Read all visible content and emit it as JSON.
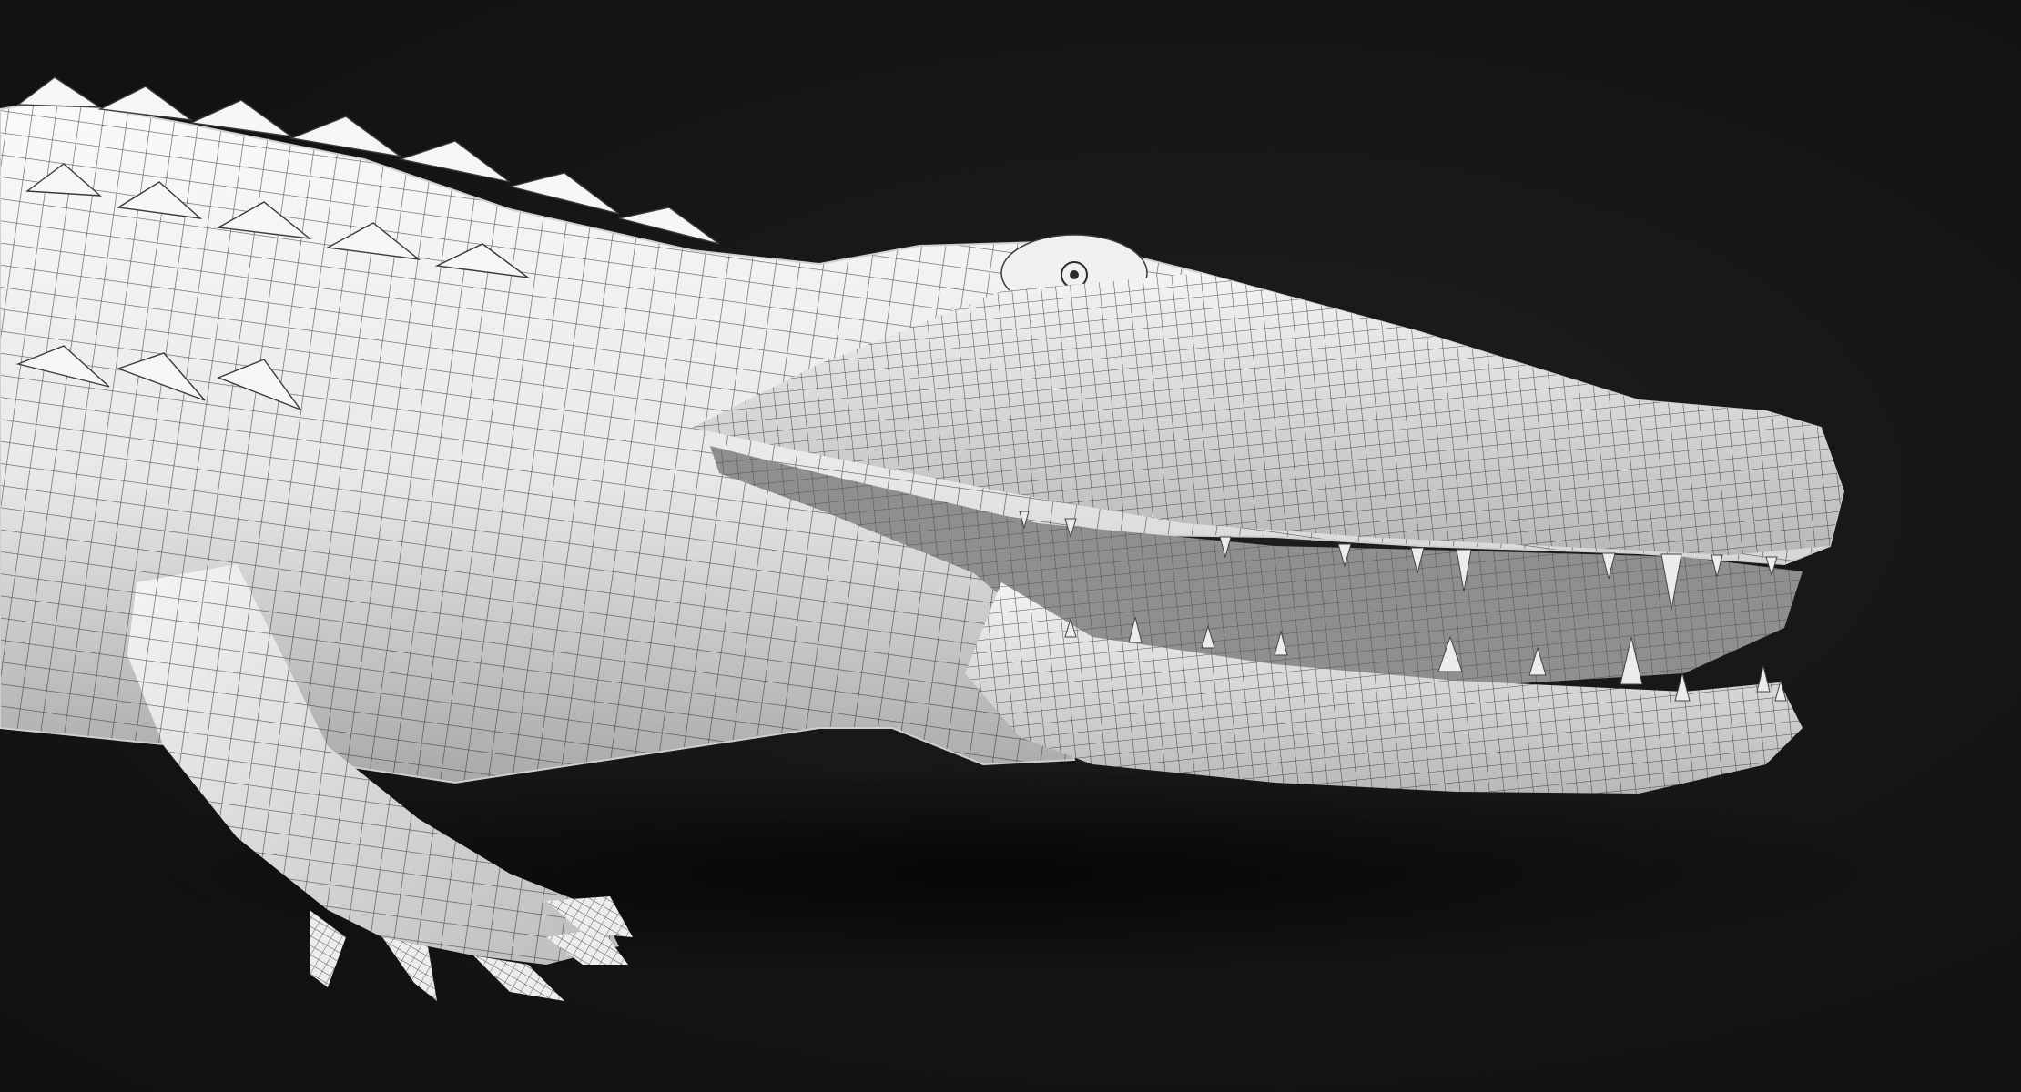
{
  "scene": {
    "subject": "crocodile-wireframe-render",
    "colors": {
      "background": "#141414",
      "skin": "#f2f2f2",
      "skin_shadow": "#b9b9b9",
      "wire": "#2a2a2a",
      "mouth_interior": "#9a9a9a",
      "teeth": "#e9e9e9"
    }
  }
}
